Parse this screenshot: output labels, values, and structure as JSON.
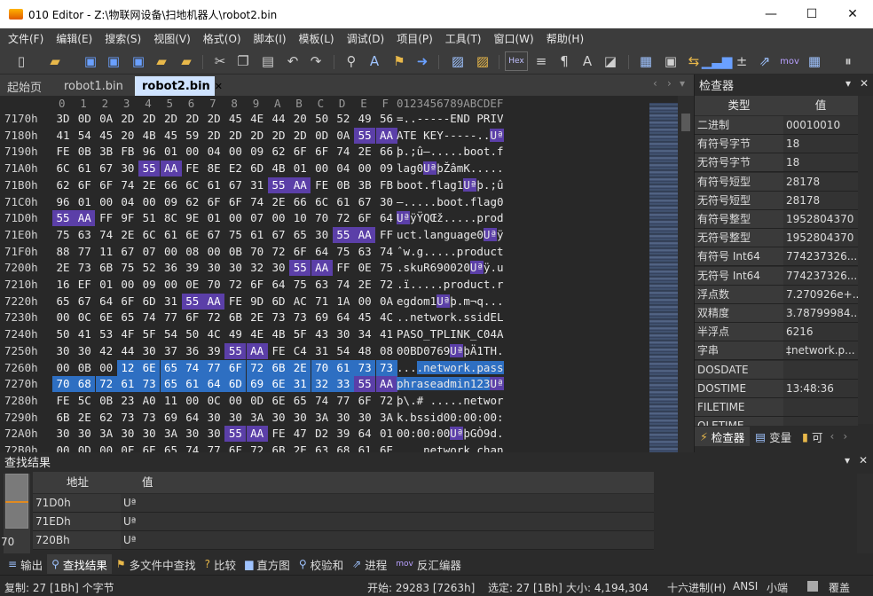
{
  "window": {
    "title": "010 Editor - Z:\\物联网设备\\扫地机器人\\robot2.bin",
    "minimize": "—",
    "maximize": "☐",
    "close": "✕"
  },
  "menu": [
    "文件(F)",
    "编辑(E)",
    "搜索(S)",
    "视图(V)",
    "格式(O)",
    "脚本(I)",
    "模板(L)",
    "调试(D)",
    "项目(P)",
    "工具(T)",
    "窗口(W)",
    "帮助(H)"
  ],
  "toolbar": {
    "hex_label": "Hex",
    "mov_label": "mov"
  },
  "tabs": {
    "start": "起始页",
    "robot1": "robot1.bin",
    "robot2": "robot2.bin",
    "close_glyph": "✕"
  },
  "hex": {
    "col_headers": [
      "0",
      "1",
      "2",
      "3",
      "4",
      "5",
      "6",
      "7",
      "8",
      "9",
      "A",
      "B",
      "C",
      "D",
      "E",
      "F"
    ],
    "ascii_header": "0123456789ABCDEF",
    "rows": [
      {
        "addr": "7170h",
        "bytes": [
          "3D",
          "0D",
          "0A",
          "2D",
          "2D",
          "2D",
          "2D",
          "2D",
          "45",
          "4E",
          "44",
          "20",
          "50",
          "52",
          "49",
          "56"
        ],
        "ascii": "=..-----END PRIV"
      },
      {
        "addr": "7180h",
        "bytes": [
          "41",
          "54",
          "45",
          "20",
          "4B",
          "45",
          "59",
          "2D",
          "2D",
          "2D",
          "2D",
          "2D",
          "0D",
          "0A",
          "55",
          "AA"
        ],
        "ascii": "ATE KEY-----..Uª"
      },
      {
        "addr": "7190h",
        "bytes": [
          "FE",
          "0B",
          "3B",
          "FB",
          "96",
          "01",
          "00",
          "04",
          "00",
          "09",
          "62",
          "6F",
          "6F",
          "74",
          "2E",
          "66"
        ],
        "ascii": "þ.;û–.....boot.f"
      },
      {
        "addr": "71A0h",
        "bytes": [
          "6C",
          "61",
          "67",
          "30",
          "55",
          "AA",
          "FE",
          "8E",
          "E2",
          "6D",
          "4B",
          "01",
          "00",
          "04",
          "00",
          "09"
        ],
        "ascii": "lag0UªþŽâmK....."
      },
      {
        "addr": "71B0h",
        "bytes": [
          "62",
          "6F",
          "6F",
          "74",
          "2E",
          "66",
          "6C",
          "61",
          "67",
          "31",
          "55",
          "AA",
          "FE",
          "0B",
          "3B",
          "FB"
        ],
        "ascii": "boot.flag1Uªþ.;û"
      },
      {
        "addr": "71C0h",
        "bytes": [
          "96",
          "01",
          "00",
          "04",
          "00",
          "09",
          "62",
          "6F",
          "6F",
          "74",
          "2E",
          "66",
          "6C",
          "61",
          "67",
          "30"
        ],
        "ascii": "–.....boot.flag0"
      },
      {
        "addr": "71D0h",
        "bytes": [
          "55",
          "AA",
          "FF",
          "9F",
          "51",
          "8C",
          "9E",
          "01",
          "00",
          "07",
          "00",
          "10",
          "70",
          "72",
          "6F",
          "64"
        ],
        "ascii": "UªÿŸQŒž.....prod"
      },
      {
        "addr": "71E0h",
        "bytes": [
          "75",
          "63",
          "74",
          "2E",
          "6C",
          "61",
          "6E",
          "67",
          "75",
          "61",
          "67",
          "65",
          "30",
          "55",
          "AA",
          "FF"
        ],
        "ascii": "uct.language0Uªÿ"
      },
      {
        "addr": "71F0h",
        "bytes": [
          "88",
          "77",
          "11",
          "67",
          "07",
          "00",
          "08",
          "00",
          "0B",
          "70",
          "72",
          "6F",
          "64",
          "75",
          "63",
          "74"
        ],
        "ascii": "ˆw.g.....product"
      },
      {
        "addr": "7200h",
        "bytes": [
          "2E",
          "73",
          "6B",
          "75",
          "52",
          "36",
          "39",
          "30",
          "30",
          "32",
          "30",
          "55",
          "AA",
          "FF",
          "0E",
          "75"
        ],
        "ascii": ".skuR690020Uªÿ.u"
      },
      {
        "addr": "7210h",
        "bytes": [
          "16",
          "EF",
          "01",
          "00",
          "09",
          "00",
          "0E",
          "70",
          "72",
          "6F",
          "64",
          "75",
          "63",
          "74",
          "2E",
          "72"
        ],
        "ascii": ".ï.....product.r"
      },
      {
        "addr": "7220h",
        "bytes": [
          "65",
          "67",
          "64",
          "6F",
          "6D",
          "31",
          "55",
          "AA",
          "FE",
          "9D",
          "6D",
          "AC",
          "71",
          "1A",
          "00",
          "0A"
        ],
        "ascii": "egdom1Uªþ.m¬q..."
      },
      {
        "addr": "7230h",
        "bytes": [
          "00",
          "0C",
          "6E",
          "65",
          "74",
          "77",
          "6F",
          "72",
          "6B",
          "2E",
          "73",
          "73",
          "69",
          "64",
          "45",
          "4C"
        ],
        "ascii": "..network.ssidEL"
      },
      {
        "addr": "7240h",
        "bytes": [
          "50",
          "41",
          "53",
          "4F",
          "5F",
          "54",
          "50",
          "4C",
          "49",
          "4E",
          "4B",
          "5F",
          "43",
          "30",
          "34",
          "41"
        ],
        "ascii": "PASO_TPLINK_C04A"
      },
      {
        "addr": "7250h",
        "bytes": [
          "30",
          "30",
          "42",
          "44",
          "30",
          "37",
          "36",
          "39",
          "55",
          "AA",
          "FE",
          "C4",
          "31",
          "54",
          "48",
          "08"
        ],
        "ascii": "00BD0769UªþÄ1TH."
      },
      {
        "addr": "7260h",
        "bytes": [
          "00",
          "0B",
          "00",
          "12",
          "6E",
          "65",
          "74",
          "77",
          "6F",
          "72",
          "6B",
          "2E",
          "70",
          "61",
          "73",
          "73"
        ],
        "ascii": "....network.pass"
      },
      {
        "addr": "7270h",
        "bytes": [
          "70",
          "68",
          "72",
          "61",
          "73",
          "65",
          "61",
          "64",
          "6D",
          "69",
          "6E",
          "31",
          "32",
          "33",
          "55",
          "AA"
        ],
        "ascii": "phraseadmin123Uª"
      },
      {
        "addr": "7280h",
        "bytes": [
          "FE",
          "5C",
          "0B",
          "23",
          "A0",
          "11",
          "00",
          "0C",
          "00",
          "0D",
          "6E",
          "65",
          "74",
          "77",
          "6F",
          "72"
        ],
        "ascii": "þ\\.# .....networ"
      },
      {
        "addr": "7290h",
        "bytes": [
          "6B",
          "2E",
          "62",
          "73",
          "73",
          "69",
          "64",
          "30",
          "30",
          "3A",
          "30",
          "30",
          "3A",
          "30",
          "30",
          "3A"
        ],
        "ascii": "k.bssid00:00:00:"
      },
      {
        "addr": "72A0h",
        "bytes": [
          "30",
          "30",
          "3A",
          "30",
          "30",
          "3A",
          "30",
          "30",
          "55",
          "AA",
          "FE",
          "47",
          "D2",
          "39",
          "64",
          "01"
        ],
        "ascii": "00:00:00UªþGÒ9d."
      },
      {
        "addr": "72B0h",
        "bytes": [
          "00",
          "0D",
          "00",
          "0F",
          "6E",
          "65",
          "74",
          "77",
          "6F",
          "72",
          "6B",
          "2E",
          "63",
          "68",
          "61",
          "6E"
        ],
        "ascii": "....network.chan"
      },
      {
        "addr": "72C0h",
        "bytes": [
          "6E",
          "65",
          "6C",
          "31",
          "55",
          "AA",
          "FE",
          "34",
          "3A",
          "E9",
          "2F",
          "01",
          "00",
          "0E",
          "00",
          "10"
        ],
        "ascii": "nel1Uªþ4:é/....."
      },
      {
        "addr": "72D0h",
        "bytes": [
          "6E",
          "65",
          "74",
          "77",
          "6F",
          "72",
          "6B",
          "2E",
          "73",
          "65",
          "63",
          "75",
          "72",
          "69",
          "74",
          "79"
        ],
        "ascii": "network.security"
      },
      {
        "addr": "72E0h",
        "bytes": [
          "35",
          "55",
          "AA",
          "FE",
          "B4",
          "5D",
          "E3",
          "31",
          "07",
          "00",
          "0F",
          "00",
          "0B",
          "6E",
          "65",
          "74"
        ],
        "ascii": "5Uªþ´]ã1.....net"
      },
      {
        "addr": "72F0h",
        "bytes": [
          "77",
          "6F",
          "72",
          "6B",
          "2E",
          "6C",
          "61",
          "6E",
          "44",
          "59",
          "4E",
          "41",
          "4D",
          "49",
          "43",
          "55"
        ],
        "ascii": "work.lanDYNAMICU"
      }
    ]
  },
  "inspector": {
    "title": "检查器",
    "col_type": "类型",
    "col_value": "值",
    "rows": [
      {
        "k": "二进制",
        "v": "00010010"
      },
      {
        "k": "有符号字节",
        "v": "18"
      },
      {
        "k": "无符号字节",
        "v": "18"
      },
      {
        "k": "有符号短型",
        "v": "28178"
      },
      {
        "k": "无符号短型",
        "v": "28178"
      },
      {
        "k": "有符号整型",
        "v": "1952804370"
      },
      {
        "k": "无符号整型",
        "v": "1952804370"
      },
      {
        "k": "有符号 Int64",
        "v": "774237326..."
      },
      {
        "k": "无符号 Int64",
        "v": "774237326..."
      },
      {
        "k": "浮点数",
        "v": "7.270926e+..."
      },
      {
        "k": "双精度",
        "v": "3.78799984..."
      },
      {
        "k": "半浮点",
        "v": "6216"
      },
      {
        "k": "字串",
        "v": "‡network.p..."
      },
      {
        "k": "DOSDATE",
        "v": ""
      },
      {
        "k": "DOSTIME",
        "v": "13:48:36"
      },
      {
        "k": "FILETIME",
        "v": ""
      },
      {
        "k": "OLETIME",
        "v": ""
      }
    ],
    "tab_inspector": "检查器",
    "tab_vars": "变量",
    "tab_more": "可"
  },
  "results": {
    "title": "查找结果",
    "col_addr": "地址",
    "col_value": "值",
    "count": "70",
    "rows": [
      {
        "a": "71D0h",
        "v": "Uª"
      },
      {
        "a": "71EDh",
        "v": "Uª"
      },
      {
        "a": "720Bh",
        "v": "Uª"
      }
    ]
  },
  "bottom_tabs": [
    "输出",
    "查找结果",
    "多文件中查找",
    "比较",
    "直方图",
    "校验和",
    "进程",
    "反汇编器"
  ],
  "status": {
    "selected": "复制: 27 [1Bh] 个字节",
    "start": "开始: 29283 [7263h]",
    "sel": "选定: 27 [1Bh]",
    "size": "大小: 4,194,304",
    "mode": "十六进制(H)",
    "enc": "ANSI",
    "endian": "小端",
    "insert": "覆盖"
  }
}
